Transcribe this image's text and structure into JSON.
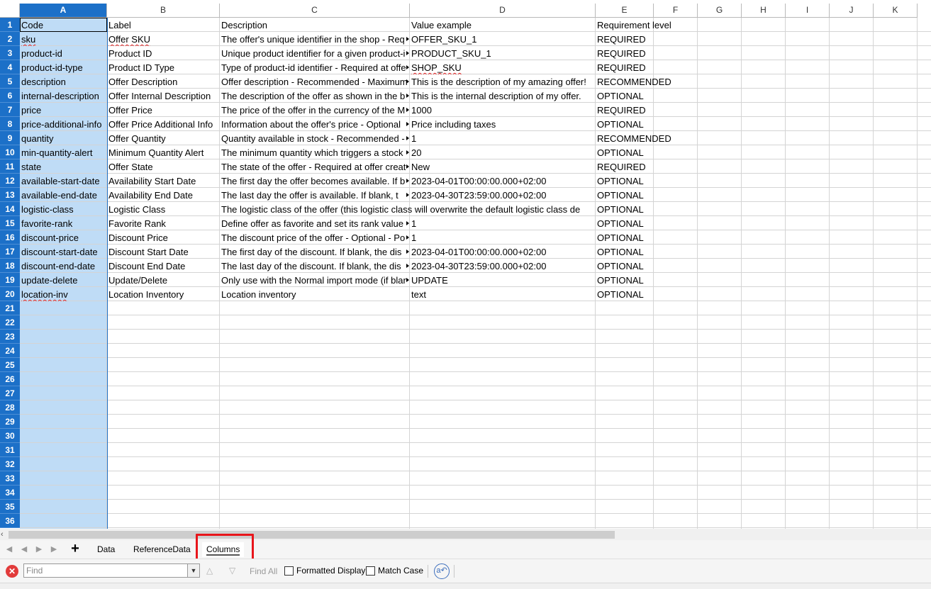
{
  "columns": [
    "A",
    "B",
    "C",
    "D",
    "E",
    "F",
    "G",
    "H",
    "I",
    "J",
    "K"
  ],
  "selected_column": "A",
  "rows": [
    [
      "Code",
      "Label",
      "Description",
      "Value example",
      "Requirement level"
    ],
    [
      "sku",
      "Offer SKU",
      "The offer's unique identifier in the shop - Req",
      "OFFER_SKU_1",
      "REQUIRED"
    ],
    [
      "product-id",
      "Product ID",
      "Unique product identifier for a given product-i",
      "PRODUCT_SKU_1",
      "REQUIRED"
    ],
    [
      "product-id-type",
      "Product ID Type",
      "Type of product-id identifier - Required at offe",
      "SHOP_SKU",
      "REQUIRED"
    ],
    [
      "description",
      "Offer Description",
      "Offer description - Recommended - Maximum",
      "This is the description of my amazing offer!",
      "RECOMMENDED"
    ],
    [
      "internal-description",
      "Offer Internal Description",
      "The description of the offer as shown in the b",
      "This is the internal description of my offer.",
      "OPTIONAL"
    ],
    [
      "price",
      "Offer Price",
      "The price of the offer in the currency of the M",
      "1000",
      "REQUIRED"
    ],
    [
      "price-additional-info",
      "Offer Price Additional Info",
      "Information about the offer's price - Optional",
      "Price including taxes",
      "OPTIONAL"
    ],
    [
      "quantity",
      "Offer Quantity",
      "Quantity available in stock - Recommended -",
      "1",
      "RECOMMENDED"
    ],
    [
      "min-quantity-alert",
      "Minimum Quantity Alert",
      "The minimum quantity which triggers a stock",
      "20",
      "OPTIONAL"
    ],
    [
      "state",
      "Offer State",
      "The state of the offer - Required at offer creat",
      "New",
      "REQUIRED"
    ],
    [
      "available-start-date",
      "Availability Start Date",
      "The first day the offer becomes available. If b",
      "2023-04-01T00:00:00.000+02:00",
      "OPTIONAL"
    ],
    [
      "available-end-date",
      "Availability End Date",
      "The last day the offer is available. If blank, t",
      "2023-04-30T23:59:00.000+02:00",
      "OPTIONAL"
    ],
    [
      "logistic-class",
      "Logistic Class",
      "The logistic class of the offer (this logistic class will overwrite the default logistic class de",
      "",
      "OPTIONAL"
    ],
    [
      "favorite-rank",
      "Favorite Rank",
      "Define offer as favorite and set its rank value",
      "1",
      "OPTIONAL"
    ],
    [
      "discount-price",
      "Discount Price",
      "The discount price of the offer - Optional - Po",
      "1",
      "OPTIONAL"
    ],
    [
      "discount-start-date",
      "Discount Start Date",
      "The first day of the discount. If blank, the dis",
      "2023-04-01T00:00:00.000+02:00",
      "OPTIONAL"
    ],
    [
      "discount-end-date",
      "Discount End Date",
      "The last day of the discount. If blank, the dis",
      "2023-04-30T23:59:00.000+02:00",
      "OPTIONAL"
    ],
    [
      "update-delete",
      "Update/Delete",
      "Only use with the Normal import mode (if blar",
      "UPDATE",
      "OPTIONAL"
    ],
    [
      "location-inv",
      "Location Inventory",
      "Location inventory",
      "text",
      "OPTIONAL"
    ]
  ],
  "row_count": 36,
  "sheet_tabs": [
    "Data",
    "ReferenceData",
    "Columns"
  ],
  "active_tab": "Columns",
  "add_sheet_label": "+",
  "find_bar": {
    "placeholder": "Find",
    "find_all": "Find All",
    "formatted_display": "Formatted Display",
    "match_case": "Match Case"
  },
  "colors": {
    "selection": "#1c70c8",
    "selected_column_fill": "#bfdcf6",
    "highlight_box": "#e8151b"
  }
}
